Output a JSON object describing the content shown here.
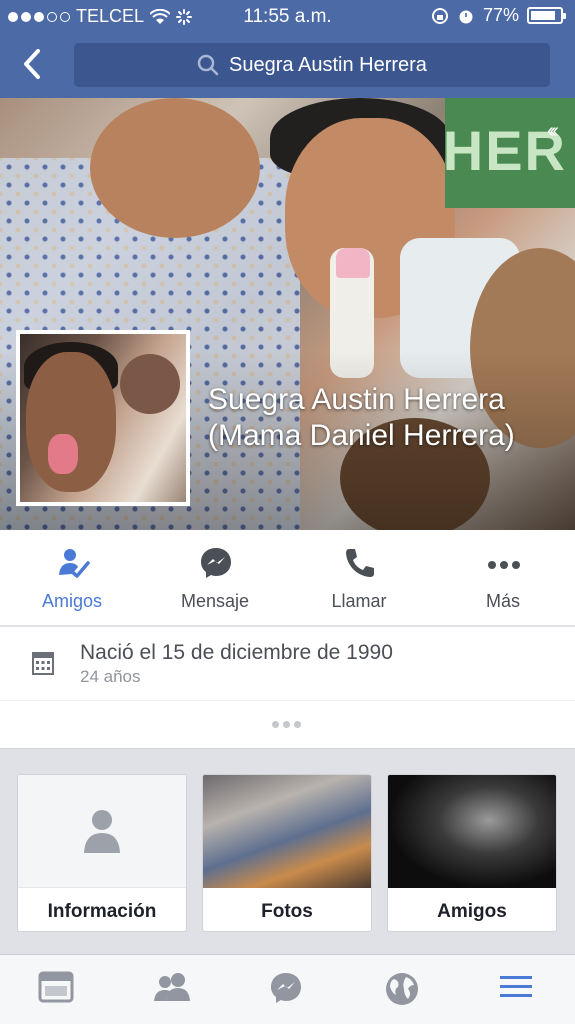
{
  "status_bar": {
    "carrier": "TELCEL",
    "time": "11:55 a.m.",
    "battery": "77%"
  },
  "search": {
    "value": "Suegra Austin Herrera"
  },
  "profile": {
    "name_line1": "Suegra Austin Herrera",
    "name_line2": "(Mama Daniel Herrera)"
  },
  "actions": [
    {
      "label": "Amigos",
      "icon": "friends-check-icon"
    },
    {
      "label": "Mensaje",
      "icon": "messenger-icon"
    },
    {
      "label": "Llamar",
      "icon": "phone-icon"
    },
    {
      "label": "Más",
      "icon": "more-icon"
    }
  ],
  "info": {
    "birthday": "Nació el 15 de diciembre de 1990",
    "age": "24 años"
  },
  "cards": [
    {
      "label": "Información"
    },
    {
      "label": "Fotos"
    },
    {
      "label": "Amigos"
    }
  ],
  "tabbar": [
    "news-feed-icon",
    "friend-requests-icon",
    "messenger-icon",
    "notifications-globe-icon",
    "menu-icon"
  ],
  "colors": {
    "brand": "#4c6aa6",
    "accent": "#4a7ad6"
  }
}
